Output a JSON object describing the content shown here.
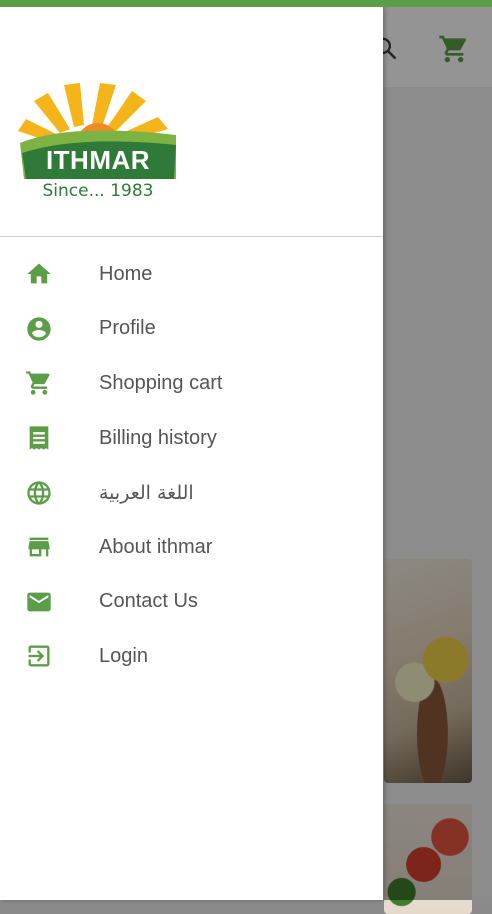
{
  "app": {
    "brand_name": "ITHMAR",
    "tagline": "Since... 1983",
    "accent_color": "#5c9e48",
    "logo_colors": {
      "sun": "#f4b41a",
      "green": "#2f7a38",
      "light_green": "#7cb342"
    }
  },
  "toolbar": {
    "icons": [
      "search-icon",
      "shopping-cart-icon"
    ]
  },
  "drawer": {
    "items": [
      {
        "label": "Home",
        "icon": "home-icon"
      },
      {
        "label": "Profile",
        "icon": "account-circle-icon"
      },
      {
        "label": "Shopping cart",
        "icon": "shopping-cart-icon"
      },
      {
        "label": "Billing history",
        "icon": "receipt-icon"
      },
      {
        "label": "اللغة العربية",
        "icon": "globe-icon"
      },
      {
        "label": "About ithmar",
        "icon": "store-icon"
      },
      {
        "label": "Contact Us",
        "icon": "mail-icon"
      },
      {
        "label": "Login",
        "icon": "login-icon"
      }
    ]
  }
}
